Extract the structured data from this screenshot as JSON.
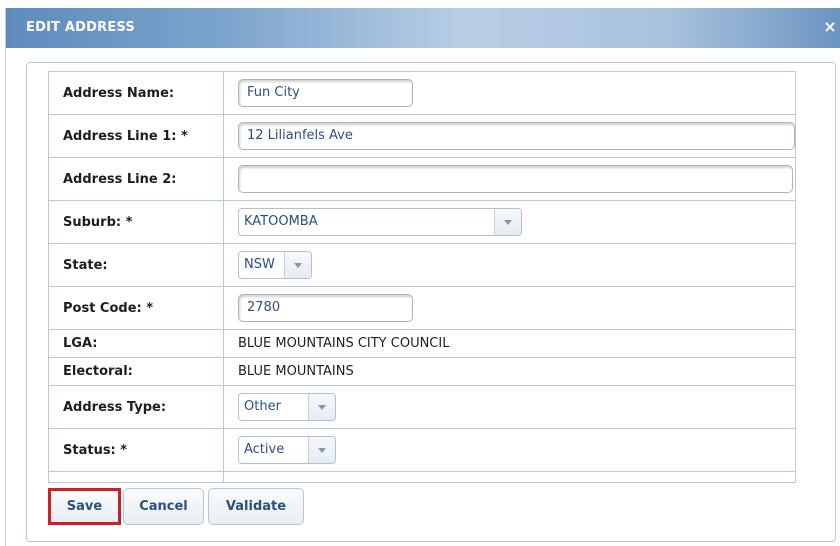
{
  "dialog": {
    "title": "EDIT ADDRESS",
    "close_glyph": "×"
  },
  "form": {
    "address_name": {
      "label": "Address Name:",
      "value": "Fun City"
    },
    "address_line1": {
      "label": "Address Line 1: *",
      "value": "12 Lilianfels Ave"
    },
    "address_line2": {
      "label": "Address Line 2:",
      "value": ""
    },
    "suburb": {
      "label": "Suburb: *",
      "value": "KATOOMBA"
    },
    "state": {
      "label": "State:",
      "value": "NSW"
    },
    "post_code": {
      "label": "Post Code: *",
      "value": "2780"
    },
    "lga": {
      "label": "LGA:",
      "value": "BLUE MOUNTAINS CITY COUNCIL"
    },
    "electoral": {
      "label": "Electoral:",
      "value": "BLUE MOUNTAINS"
    },
    "address_type": {
      "label": "Address Type:",
      "value": "Other"
    },
    "status": {
      "label": "Status: *",
      "value": "Active"
    }
  },
  "buttons": {
    "save": "Save",
    "cancel": "Cancel",
    "validate": "Validate"
  },
  "colors": {
    "title_bar": "#7aa2cc",
    "highlight": "#cc2027",
    "value_text": "#2c4f80"
  }
}
